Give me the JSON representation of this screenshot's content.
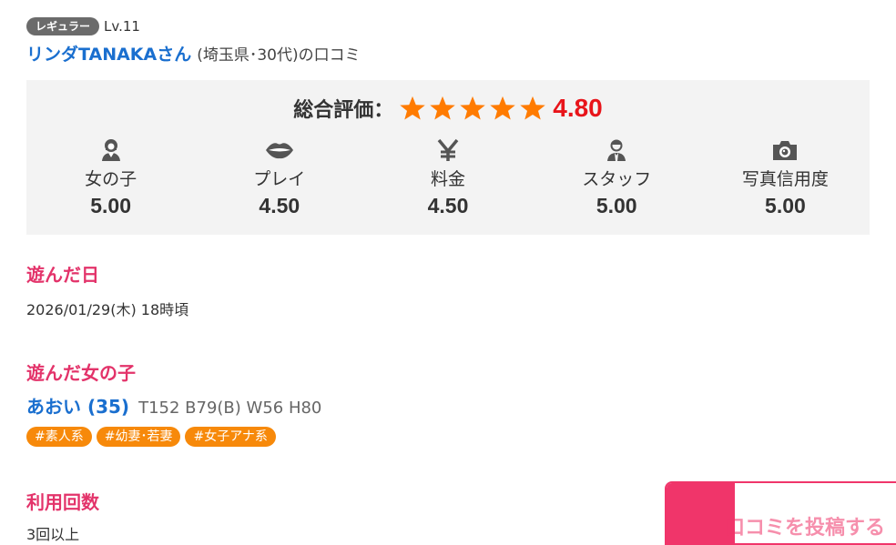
{
  "reviewer": {
    "rank_badge": "レギュラー",
    "level": "Lv.11",
    "name": "リンダTANAKAさん",
    "meta": "(埼玉県･30代)の口コミ"
  },
  "rating": {
    "overall_label": "総合評価：",
    "overall_score": "4.80",
    "stars_filled": 5,
    "stars_total": 5,
    "star_color": "#ff7b00",
    "categories": [
      {
        "icon": "girl-icon",
        "label": "女の子",
        "score": "5.00"
      },
      {
        "icon": "lips-icon",
        "label": "プレイ",
        "score": "4.50"
      },
      {
        "icon": "yen-icon",
        "label": "料金",
        "score": "4.50"
      },
      {
        "icon": "staff-icon",
        "label": "スタッフ",
        "score": "5.00"
      },
      {
        "icon": "camera-icon",
        "label": "写真信用度",
        "score": "5.00"
      }
    ]
  },
  "visit_date": {
    "heading": "遊んだ日",
    "value": "2026/01/29(木) 18時頃"
  },
  "girl": {
    "heading": "遊んだ女の子",
    "name": "あおい (35)",
    "spec": "T152 B79(B) W56 H80",
    "tags": [
      "#素人系",
      "#幼妻･若妻",
      "#女子アナ系"
    ]
  },
  "usage": {
    "heading": "利用回数",
    "value": "3回以上"
  },
  "post_button": {
    "label": "口コミを投稿する"
  },
  "colors": {
    "accent_pink": "#e3336a",
    "link_blue": "#1a6fcf",
    "tag_orange": "#f7890a",
    "score_red": "#e8141a"
  }
}
